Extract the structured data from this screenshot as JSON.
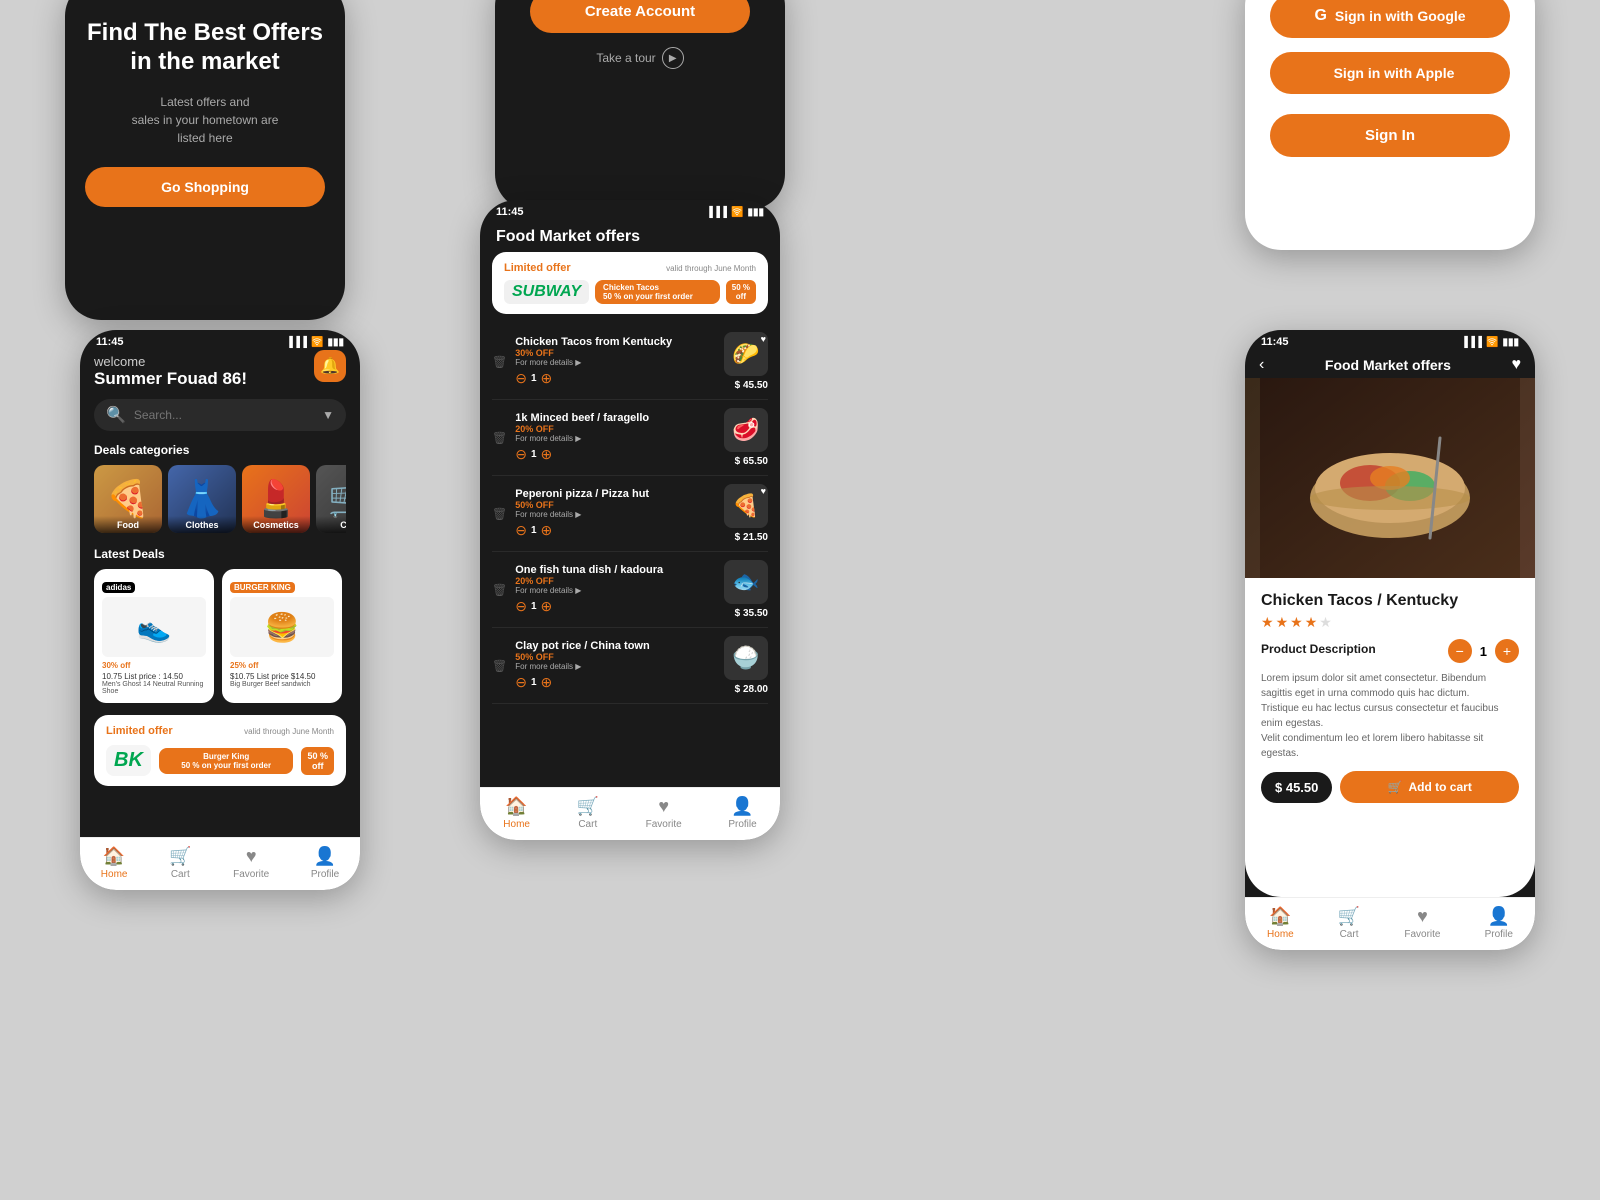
{
  "app": {
    "accent": "#e8731a",
    "bg": "#d0d0d0"
  },
  "phone0": {
    "title": "Find The Best Offers\nin the market",
    "subtitle": "Latest offers and\nsales in your hometown are\nlisted here",
    "cta": "Go Shopping"
  },
  "phone1": {
    "time": "11:45",
    "welcome": "welcome",
    "username": "Summer Fouad 86!",
    "search_placeholder": "Search...",
    "section_categories": "Deals categories",
    "categories": [
      {
        "id": "food",
        "label": "Food",
        "emoji": "🍕"
      },
      {
        "id": "clothes",
        "label": "Clothes",
        "emoji": "👗"
      },
      {
        "id": "cosmetics",
        "label": "Cosmetics",
        "emoji": "💄"
      },
      {
        "id": "more",
        "label": "Ch...",
        "emoji": "🛒"
      }
    ],
    "section_latest": "Latest Deals",
    "deals": [
      {
        "brand": "adidas",
        "badge": "30% off",
        "badge_type": "black",
        "price": "10.75 List price : 14.50",
        "name": "Men's Ghost 14 Neutral Running Shoe",
        "emoji": "👟"
      },
      {
        "brand": "BURGER KING",
        "badge": "25% off",
        "badge_type": "orange",
        "price": "$10.75 List price $14.50",
        "name": "Big Burger Beef sandwich",
        "emoji": "🍔"
      }
    ],
    "limited_offer": {
      "title": "Limited offer",
      "valid": "valid through June Month",
      "logo": "BURGER KING",
      "deal_text": "Burger King\n50 % on your first order",
      "pct": "50 %\noff"
    },
    "nav": [
      {
        "label": "Home",
        "icon": "🏠",
        "active": true
      },
      {
        "label": "Cart",
        "icon": "🛒",
        "active": false
      },
      {
        "label": "Favorite",
        "icon": "♥",
        "active": false
      },
      {
        "label": "Profile",
        "icon": "👤",
        "active": false
      }
    ]
  },
  "phone2": {
    "create_account": "Create Account",
    "take_tour": "Take a tour"
  },
  "phone3": {
    "sign_in_google": "Sign in with Google",
    "sign_in_apple": "Sign in with Apple",
    "sign_in": "Sign In"
  },
  "phone4": {
    "time": "11:45",
    "title": "Food Market offers",
    "limited": {
      "title": "Limited offer",
      "valid": "valid through June Month",
      "logo": "SUBWAY",
      "deal_text": "Chicken Tacos\n50 % on your first order",
      "pct": "50 %\noff"
    },
    "items": [
      {
        "name": "Chicken Tacos from Kentucky",
        "off": "30% OFF",
        "qty": 1,
        "price": "$ 45.50",
        "emoji": "🌮",
        "heart": true
      },
      {
        "name": "1k Minced beef / faragello",
        "off": "20% OFF",
        "qty": 1,
        "price": "$ 65.50",
        "emoji": "🥩",
        "heart": false
      },
      {
        "name": "Peperoni pizza / Pizza hut",
        "off": "50% OFF",
        "qty": 1,
        "price": "$ 21.50",
        "emoji": "🍕",
        "heart": true
      },
      {
        "name": "One fish tuna dish / kadoura",
        "off": "20% OFF",
        "qty": 1,
        "price": "$ 35.50",
        "emoji": "🐟",
        "heart": false
      },
      {
        "name": "Clay pot rice / China town",
        "off": "50% OFF",
        "qty": 1,
        "price": "$ 28.00",
        "emoji": "🍚",
        "heart": false
      }
    ],
    "nav": [
      {
        "label": "Home",
        "icon": "🏠",
        "active": true
      },
      {
        "label": "Cart",
        "icon": "🛒",
        "active": false
      },
      {
        "label": "Favorite",
        "icon": "♥",
        "active": false
      },
      {
        "label": "Profile",
        "icon": "👤",
        "active": false
      }
    ]
  },
  "phone5": {
    "time": "11:45",
    "title": "Food Market offers",
    "product_name": "Chicken Tacos / Kentucky",
    "stars": 3.5,
    "qty": 1,
    "desc_label": "Product Description",
    "desc": "Lorem ipsum dolor sit amet consectetur. Bibendum sagittis eget in urna commodo quis hac dictum.\nTristique eu hac lectus cursus consectetur et faucibus enim egestas.\nVelit condimentum leo et lorem libero habitasse sit egestas.",
    "price": "$ 45.50",
    "add_to_cart": "Add to cart",
    "emoji_hero": "🌯",
    "nav": [
      {
        "label": "Home",
        "icon": "🏠",
        "active": true
      },
      {
        "label": "Cart",
        "icon": "🛒",
        "active": false
      },
      {
        "label": "Favorite",
        "icon": "♥",
        "active": false
      },
      {
        "label": "Profile",
        "icon": "👤",
        "active": false
      }
    ]
  }
}
